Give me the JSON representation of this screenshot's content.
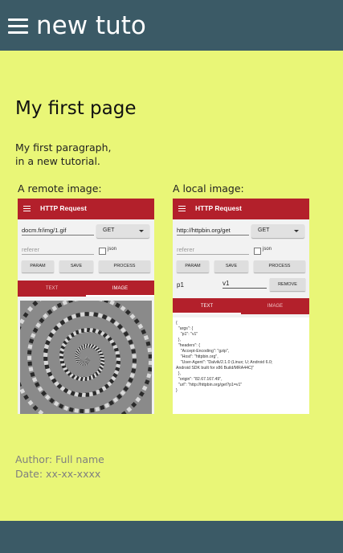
{
  "app": {
    "title": "new tuto"
  },
  "page": {
    "title": "My first page",
    "paragraph_line1": "My first paragraph,",
    "paragraph_line2": "in a new tutorial.",
    "remote_caption": "A remote image:",
    "local_caption": "A local image:",
    "author": "Author: Full name",
    "date": "Date: xx-xx-xxxx"
  },
  "remote_shot": {
    "title": "HTTP Request",
    "url": "docm.fr/img/1.gif",
    "method": "GET",
    "referer_placeholder": "referer",
    "json_label": "json",
    "buttons": [
      "PARAM",
      "SAVE",
      "PROCESS"
    ],
    "tabs": [
      "TEXT",
      "IMAGE"
    ],
    "active_tab": "IMAGE"
  },
  "local_shot": {
    "title": "HTTP Request",
    "url": "http://httpbin.org/get",
    "method": "GET",
    "referer_placeholder": "referer",
    "json_label": "json",
    "buttons": [
      "PARAM",
      "SAVE",
      "PROCESS"
    ],
    "param_key": "p1",
    "param_value": "v1",
    "remove_label": "REMOVE",
    "tabs": [
      "TEXT",
      "IMAGE"
    ],
    "active_tab": "TEXT",
    "response": "{\n  \"args\": {\n    \"p1\": \"v1\"\n  },\n  \"headers\": {\n    \"Accept-Encoding\": \"gzip\",\n    \"Host\": \"httpbin.org\",\n    \"User-Agent\": \"Dalvik/2.1.0 (Linux; U; Android 6.0;\nAndroid SDK built for x86 Build/MRA44C)\"\n  },\n  \"origin\": \"82.67.167.49\",\n  \"url\": \"http://httpbin.org/get?p1=v1\"\n}"
  },
  "colors": {
    "background": "#e9f677",
    "bar": "#3b5a66",
    "accent": "#b3202b"
  }
}
